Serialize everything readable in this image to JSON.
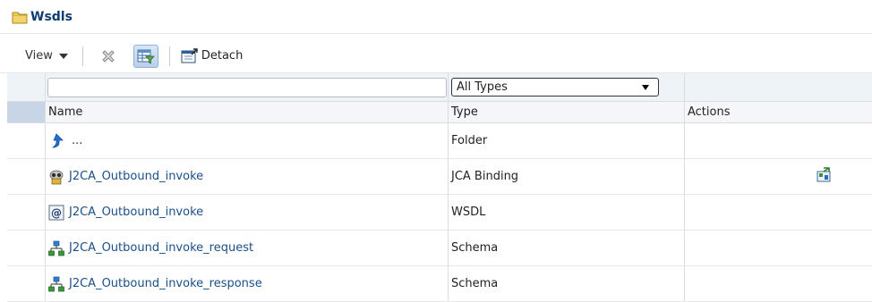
{
  "header": {
    "title": "Wsdls",
    "icon": "folder-icon"
  },
  "toolbar": {
    "view_label": "View",
    "delete_icon": "delete-x-icon",
    "filter_icon": "query-by-example-icon",
    "detach_label": "Detach"
  },
  "filter": {
    "name_value": "",
    "type_selected": "All Types"
  },
  "table": {
    "columns": [
      "Name",
      "Type",
      "Actions"
    ],
    "rows": [
      {
        "icon": "up-arrow-icon",
        "name": "...",
        "type": "Folder",
        "action": ""
      },
      {
        "icon": "jca-binding-icon",
        "name": "J2CA_Outbound_invoke",
        "type": "JCA Binding",
        "action": "edit-binding-icon"
      },
      {
        "icon": "wsdl-icon",
        "name": "J2CA_Outbound_invoke",
        "type": "WSDL",
        "action": ""
      },
      {
        "icon": "schema-icon",
        "name": "J2CA_Outbound_invoke_request",
        "type": "Schema",
        "action": ""
      },
      {
        "icon": "schema-icon",
        "name": "J2CA_Outbound_invoke_response",
        "type": "Schema",
        "action": ""
      }
    ]
  },
  "colors": {
    "title": "#0c3d6e",
    "link": "#1a4f8a",
    "selector_column": "#c8d5e6",
    "filter_row": "#eef3f8"
  }
}
